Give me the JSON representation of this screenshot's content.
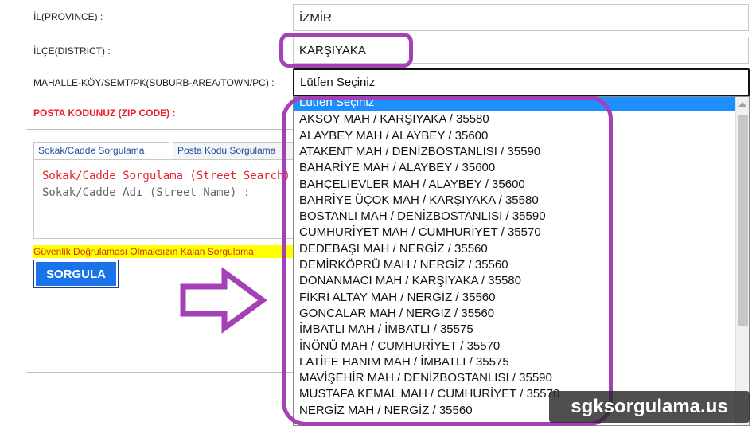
{
  "form": {
    "province_label": "İL(PROVINCE) :",
    "province_value": "İZMİR",
    "district_label": "İLÇE(DISTRICT) :",
    "district_value": "KARŞIYAKA",
    "neighborhood_label": "MAHALLE-KÖY/SEMT/PK(SUBURB-AREA/TOWN/PC) :",
    "neighborhood_value": "Lütfen Seçiniz",
    "zip_label": "POSTA KODUNUZ (ZIP CODE) :"
  },
  "dropdown": {
    "options": [
      "Lütfen Seçiniz",
      "AKSOY MAH / KARŞIYAKA / 35580",
      "ALAYBEY MAH / ALAYBEY / 35600",
      "ATAKENT MAH / DENİZBOSTANLISI / 35590",
      "BAHARİYE MAH / ALAYBEY / 35600",
      "BAHÇELİEVLER MAH / ALAYBEY / 35600",
      "BAHRİYE ÜÇOK MAH / KARŞIYAKA / 35580",
      "BOSTANLI MAH / DENİZBOSTANLISI / 35590",
      "CUMHURİYET MAH / CUMHURİYET / 35570",
      "DEDEBAŞI MAH / NERGİZ / 35560",
      "DEMİRKÖPRÜ MAH / NERGİZ / 35560",
      "DONANMACI MAH / KARŞIYAKA / 35580",
      "FİKRİ ALTAY MAH / NERGİZ / 35560",
      "GONCALAR MAH / NERGİZ / 35560",
      "İMBATLI MAH / İMBATLI / 35575",
      "İNÖNÜ MAH / CUMHURİYET / 35570",
      "LATİFE HANIM MAH / İMBATLI / 35575",
      "MAVİŞEHİR MAH / DENİZBOSTANLISI / 35590",
      "MUSTAFA KEMAL MAH / CUMHURİYET / 35570",
      "NERGİZ MAH / NERGİZ / 35560"
    ]
  },
  "tabs": {
    "street_search": "Sokak/Cadde Sorgulama",
    "zip_search": "Posta Kodu Sorgulama"
  },
  "street_panel": {
    "title": "Sokak/Cadde Sorgulama (Street Search)",
    "name_label": "Sokak/Cadde Adı (Street Name) :"
  },
  "notice": "Güvenlik Doğrulaması Olmaksızın Kalan Sorgulama",
  "search_button": "SORGULA",
  "watermark": "sgksorgulama.us",
  "colors": {
    "highlight": "#a441b4",
    "selected_option": "#1e8fff",
    "zip_label": "#e8202a",
    "street_title": "#e8202a",
    "notice_background": "#ffff00",
    "button": "#1a73e8"
  }
}
